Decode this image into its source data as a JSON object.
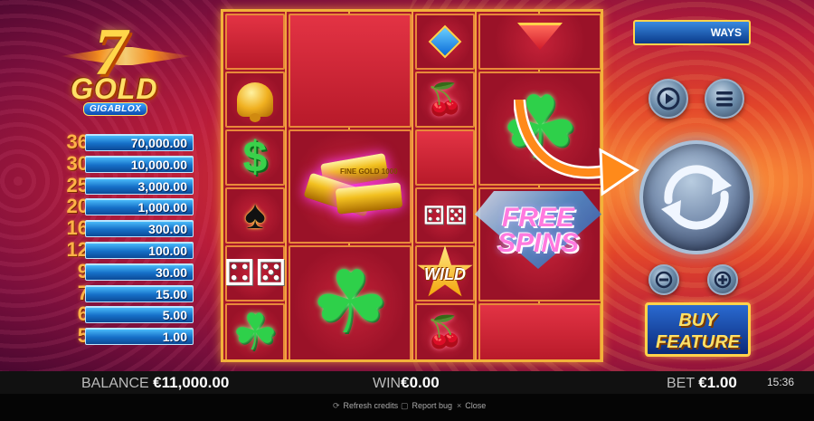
{
  "game": {
    "logo": {
      "number": "7",
      "word": "GOLD",
      "sub": "GIGABLOX"
    },
    "ways_label": "WAYS",
    "paytable": [
      {
        "count": "36",
        "amount": "70,000.00"
      },
      {
        "count": "30",
        "amount": "10,000.00"
      },
      {
        "count": "25",
        "amount": "3,000.00"
      },
      {
        "count": "20",
        "amount": "1,000.00"
      },
      {
        "count": "16",
        "amount": "300.00"
      },
      {
        "count": "12",
        "amount": "100.00"
      },
      {
        "count": "9",
        "amount": "30.00"
      },
      {
        "count": "7",
        "amount": "15.00"
      },
      {
        "count": "6",
        "amount": "5.00"
      },
      {
        "count": "5",
        "amount": "1.00"
      }
    ],
    "symbols": {
      "wild": "WILD",
      "free_spins_line1": "FREE",
      "free_spins_line2": "SPINS",
      "gold_bar_text": "FINE GOLD 1000"
    },
    "buy_feature": {
      "line1": "BUY",
      "line2": "FEATURE"
    }
  },
  "status": {
    "balance_label": "BALANCE",
    "balance_value": "€11,000.00",
    "win_label": "WIN",
    "win_value": "€0.00",
    "bet_label": "BET",
    "bet_value": "€1.00",
    "clock": "15:36"
  },
  "footer": {
    "refresh": "Refresh credits",
    "report": "Report bug",
    "close": "Close"
  },
  "colors": {
    "accent_gold": "#f2b23a",
    "reel_red": "#a8182a",
    "button_blue": "#1670c8"
  }
}
